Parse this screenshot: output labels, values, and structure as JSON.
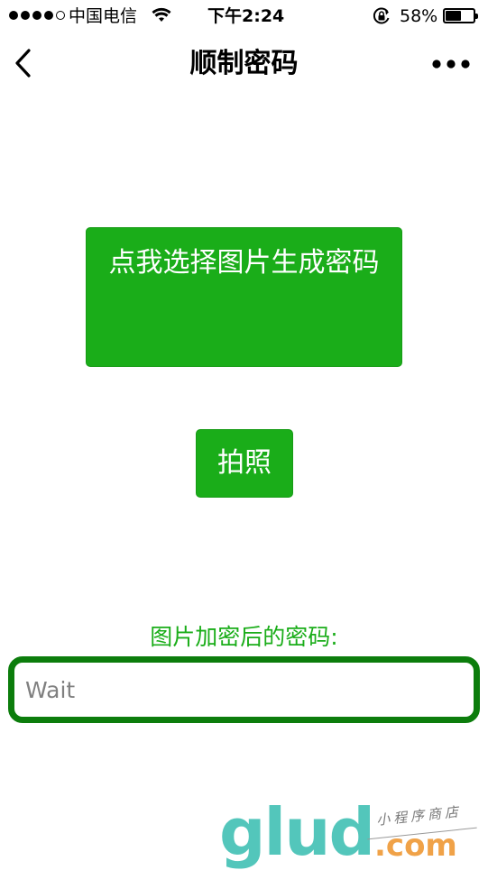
{
  "status_bar": {
    "carrier": "中国电信",
    "time": "下午2:24",
    "battery_percent": "58%",
    "battery_level": 0.58,
    "signal_bars_filled": 4,
    "signal_bars_total": 5
  },
  "nav": {
    "title": "顺制密码",
    "back_icon": "chevron-left-icon",
    "more_icon": "more-dots-icon"
  },
  "main": {
    "select_image_button_label": "点我选择图片生成密码",
    "take_photo_button_label": "拍照",
    "result_label": "图片加密后的密码:",
    "password_field": {
      "value": "",
      "placeholder": "Wait"
    }
  },
  "watermark": {
    "logo": "glud",
    "domain_suffix": ".com",
    "tagline": "小程序商店"
  },
  "colors": {
    "accent_green": "#1aad19",
    "field_border": "#0c7d0c",
    "watermark_teal": "#41c0b4",
    "watermark_orange": "#f0a248"
  }
}
